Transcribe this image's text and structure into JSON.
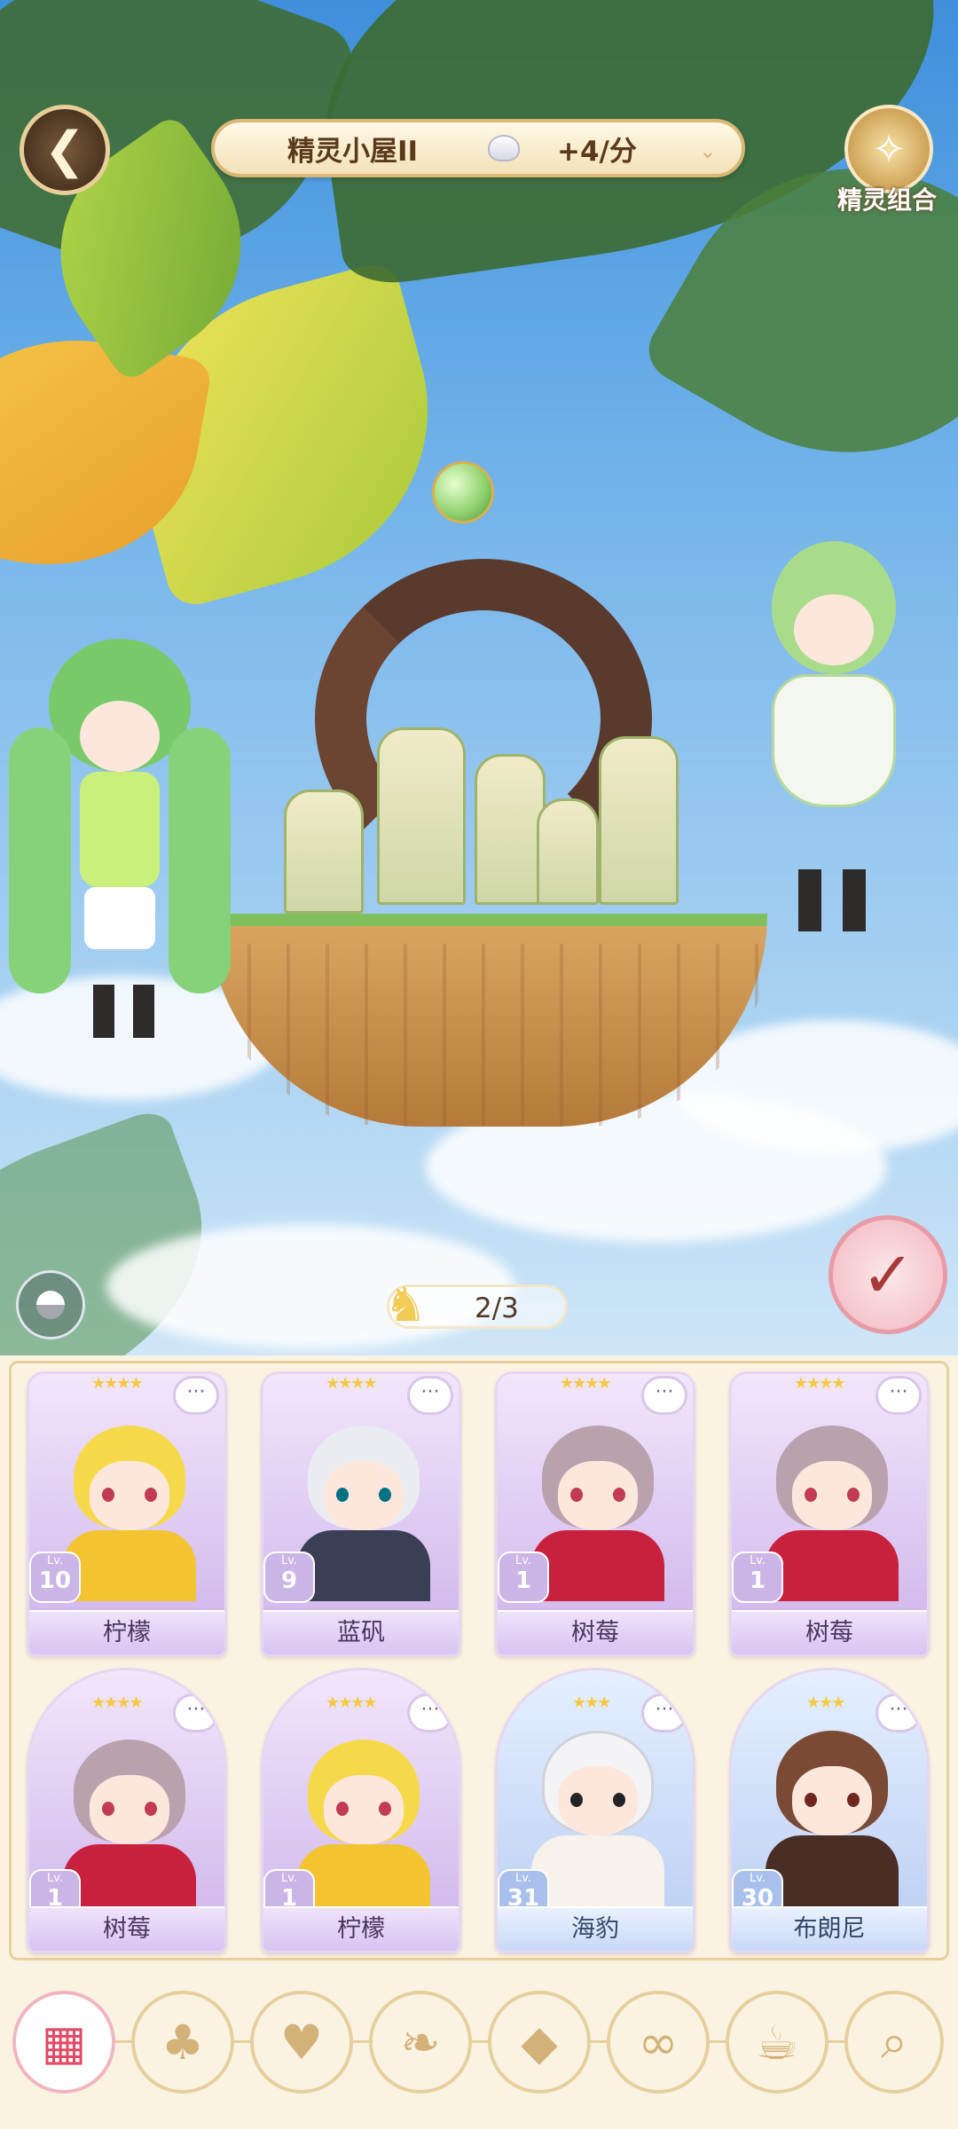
{
  "header": {
    "house_title": "精灵小屋II",
    "rate": "+4/分",
    "combo_label": "精灵组合"
  },
  "scene": {
    "slots_counter": "2/3"
  },
  "cards": [
    {
      "name": "柠檬",
      "level": "10",
      "level_prefix": "Lv.",
      "stars": "★★★★",
      "theme": "lemon"
    },
    {
      "name": "蓝矾",
      "level": "9",
      "level_prefix": "Lv.",
      "stars": "★★★★",
      "theme": "silver"
    },
    {
      "name": "树莓",
      "level": "1",
      "level_prefix": "Lv.",
      "stars": "★★★★",
      "theme": "berry"
    },
    {
      "name": "树莓",
      "level": "1",
      "level_prefix": "Lv.",
      "stars": "★★★★",
      "theme": "berry"
    },
    {
      "name": "树莓",
      "level": "1",
      "level_prefix": "Lv.",
      "stars": "★★★★",
      "theme": "berry"
    },
    {
      "name": "柠檬",
      "level": "1",
      "level_prefix": "Lv.",
      "stars": "★★★★",
      "theme": "lemon"
    },
    {
      "name": "海豹",
      "level": "31",
      "level_prefix": "Lv.",
      "stars": "★★★",
      "theme": "seal"
    },
    {
      "name": "布朗尼",
      "level": "30",
      "level_prefix": "Lv.",
      "stars": "★★★",
      "theme": "brownie"
    }
  ],
  "icons": {
    "back": "back-arrow-icon",
    "combo": "fairy-combo-icon",
    "confirm": "checkmark-icon",
    "toggle": "view-toggle-icon",
    "chat": "chat-bubble-icon"
  },
  "bottom_nav": [
    {
      "name": "all-filter",
      "glyph": "▦"
    },
    {
      "name": "clover-filter",
      "glyph": "♣"
    },
    {
      "name": "heart-filter",
      "glyph": "♥"
    },
    {
      "name": "swan-filter",
      "glyph": "❧"
    },
    {
      "name": "diamond-filter",
      "glyph": "◆"
    },
    {
      "name": "glasses-filter",
      "glyph": "∞"
    },
    {
      "name": "teacup-filter",
      "glyph": "☕"
    },
    {
      "name": "search",
      "glyph": "⌕"
    }
  ],
  "colors": {
    "accent_pink": "#e14a66",
    "gold_border": "#e6cf9e",
    "card_purple": "#cdb3ea",
    "card_blue": "#b9cdf2"
  }
}
